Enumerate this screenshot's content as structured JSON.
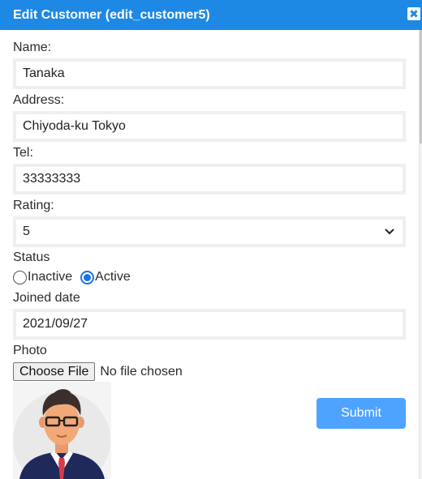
{
  "dialog": {
    "title": "Edit Customer (edit_customer5)",
    "close_icon": "close-icon",
    "close_symbol": "✖"
  },
  "form": {
    "name_label": "Name:",
    "name_value": "Tanaka",
    "address_label": "Address:",
    "address_value": "Chiyoda-ku Tokyo",
    "tel_label": "Tel:",
    "tel_value": "33333333",
    "rating_label": "Rating:",
    "rating_value": "5",
    "status_label": "Status",
    "status_options": [
      "Inactive",
      "Active"
    ],
    "status_selected": "Active",
    "joined_label": "Joined date",
    "joined_value": "2021/09/27",
    "photo_label": "Photo",
    "choose_file_label": "Choose File",
    "file_status": "No file chosen",
    "photo_icon": "person-avatar-image",
    "submit_label": "Submit"
  },
  "colors": {
    "titlebar": "#1e88e5",
    "submit": "#4da3ff",
    "radio_checked": "#1a73e8"
  }
}
